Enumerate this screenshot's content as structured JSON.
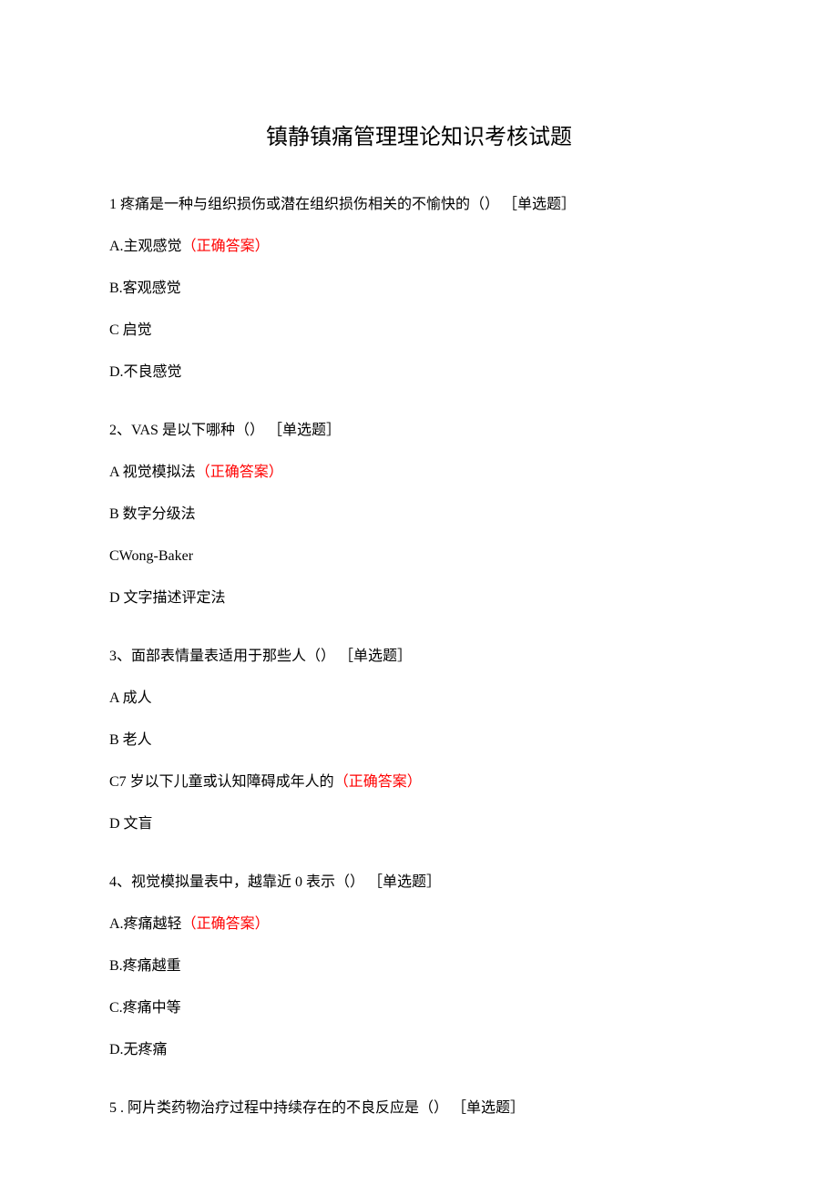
{
  "title": "镇静镇痛管理理论知识考核试题",
  "correct_label": "（正确答案）",
  "questions": [
    {
      "q": "1 疼痛是一种与组织损伤或潜在组织损伤相关的不愉快的（） ［单选题］",
      "options": [
        {
          "text": "A.主观感觉",
          "correct": true
        },
        {
          "text": "B.客观感觉",
          "correct": false
        },
        {
          "text": "C 启觉",
          "correct": false
        },
        {
          "text": "D.不良感觉",
          "correct": false
        }
      ]
    },
    {
      "q": "2、VAS 是以下哪种（） ［单选题］",
      "options": [
        {
          "text": "A 视觉模拟法",
          "correct": true
        },
        {
          "text": "B 数字分级法",
          "correct": false
        },
        {
          "text": "CWong-Baker",
          "correct": false
        },
        {
          "text": "D 文字描述评定法",
          "correct": false
        }
      ]
    },
    {
      "q": "3、面部表情量表适用于那些人（） ［单选题］",
      "options": [
        {
          "text": "A 成人",
          "correct": false
        },
        {
          "text": "B 老人",
          "correct": false
        },
        {
          "text": "C7 岁以下儿童或认知障碍成年人的",
          "correct": true
        },
        {
          "text": "D 文盲",
          "correct": false
        }
      ]
    },
    {
      "q": "4、视觉模拟量表中，越靠近 0 表示（） ［单选题］",
      "options": [
        {
          "text": "A.疼痛越轻",
          "correct": true
        },
        {
          "text": "B.疼痛越重",
          "correct": false
        },
        {
          "text": "C.疼痛中等",
          "correct": false
        },
        {
          "text": "D.无疼痛",
          "correct": false
        }
      ]
    },
    {
      "q": "5  . 阿片类药物治疗过程中持续存在的不良反应是（） ［单选题］",
      "options": []
    }
  ]
}
